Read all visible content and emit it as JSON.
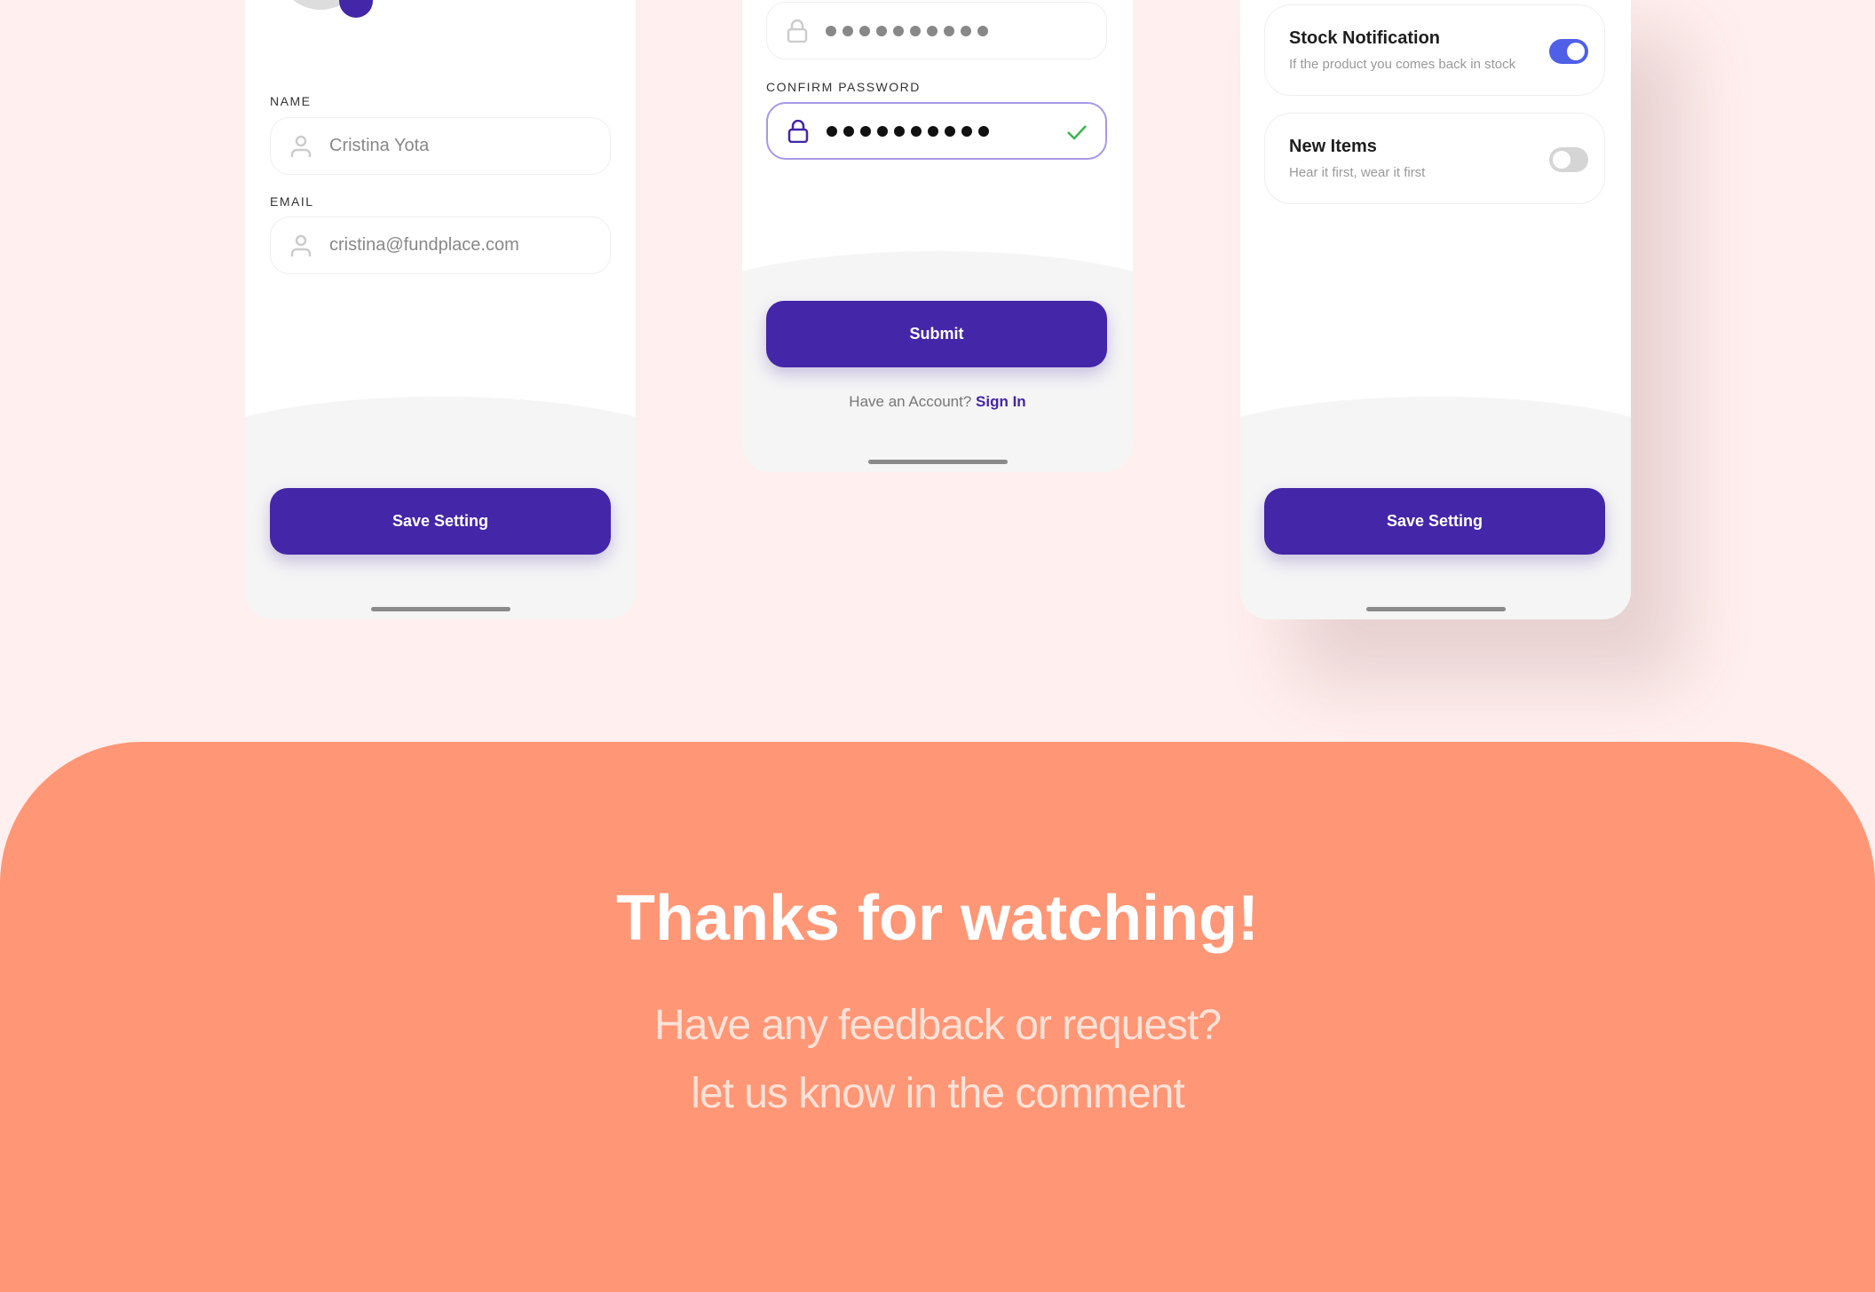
{
  "profile_screen": {
    "name_label": "NAME",
    "name_value": "Cristina Yota",
    "email_label": "EMAIL",
    "email_value": "cristina@fundplace.com",
    "save_label": "Save Setting"
  },
  "password_screen": {
    "confirm_label": "CONFIRM PASSWORD",
    "submit_label": "Submit",
    "account_prompt": "Have an Account?",
    "sign_in_link": "Sign In"
  },
  "notification_screen": {
    "items": [
      {
        "title": "Stock Notification",
        "subtitle": "If the product you comes back in stock",
        "enabled": true
      },
      {
        "title": "New Items",
        "subtitle": "Hear it first, wear it first",
        "enabled": false
      }
    ],
    "save_label": "Save Setting"
  },
  "footer": {
    "title": "Thanks for watching!",
    "line1": "Have any feedback or request?",
    "line2": "let us know in the comment"
  },
  "colors": {
    "primary": "#4426A8",
    "toggle_on": "#4F5FE8",
    "accent_bg": "#FF9676",
    "success": "#3BB54A"
  }
}
